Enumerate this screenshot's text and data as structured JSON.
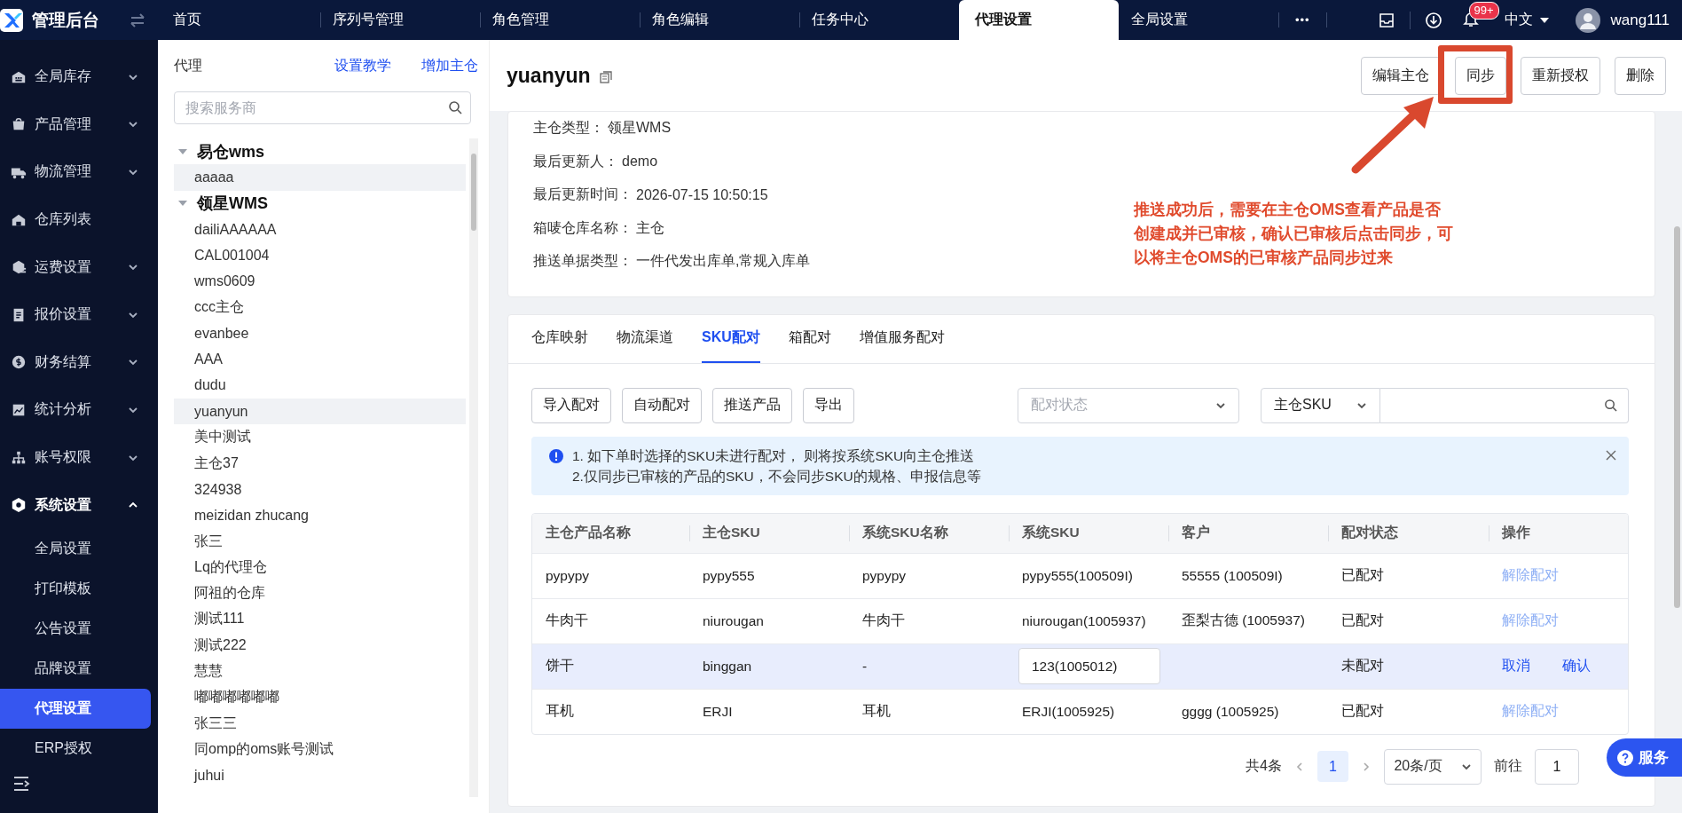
{
  "topbar": {
    "logo": "管理后台",
    "tabs": [
      {
        "label": "首页",
        "selected": false
      },
      {
        "label": "序列号管理",
        "selected": false
      },
      {
        "label": "角色管理",
        "selected": false
      },
      {
        "label": "角色编辑",
        "selected": false
      },
      {
        "label": "任务中心",
        "selected": false
      },
      {
        "label": "代理设置",
        "selected": true
      },
      {
        "label": "全局设置",
        "selected": false
      }
    ],
    "more": "•••",
    "badge": "99+",
    "language": "中文",
    "user": "wang111"
  },
  "sidebar": {
    "items": [
      {
        "label": "全局库存",
        "kind": "group",
        "expanded": false
      },
      {
        "label": "产品管理",
        "kind": "group",
        "expanded": false
      },
      {
        "label": "物流管理",
        "kind": "group",
        "expanded": false
      },
      {
        "label": "仓库列表",
        "kind": "link"
      },
      {
        "label": "运费设置",
        "kind": "group",
        "expanded": false
      },
      {
        "label": "报价设置",
        "kind": "group",
        "expanded": false
      },
      {
        "label": "财务结算",
        "kind": "group",
        "expanded": false
      },
      {
        "label": "统计分析",
        "kind": "group",
        "expanded": false
      },
      {
        "label": "账号权限",
        "kind": "group",
        "expanded": false
      },
      {
        "label": "系统设置",
        "kind": "group",
        "expanded": true,
        "children": [
          {
            "label": "全局设置",
            "selected": false
          },
          {
            "label": "打印模板",
            "selected": false
          },
          {
            "label": "公告设置",
            "selected": false
          },
          {
            "label": "品牌设置",
            "selected": false
          },
          {
            "label": "代理设置",
            "selected": true
          },
          {
            "label": "ERP授权",
            "selected": false
          }
        ]
      }
    ]
  },
  "agent_panel": {
    "title": "代理",
    "links": [
      "设置教学",
      "增加主仓"
    ],
    "search": {
      "placeholder": "搜索服务商"
    },
    "tree": [
      {
        "label": "易仓wms",
        "expanded": true,
        "children": [
          {
            "label": "aaaaa",
            "selected": false,
            "hovered": true
          }
        ]
      },
      {
        "label": "领星WMS",
        "expanded": true,
        "children": [
          {
            "label": "dailiAAAAAA",
            "selected": false,
            "hovered": false
          },
          {
            "label": "CAL001004",
            "selected": false,
            "hovered": false
          },
          {
            "label": "wms0609",
            "selected": false,
            "hovered": false
          },
          {
            "label": "ccc主仓",
            "selected": false,
            "hovered": false
          },
          {
            "label": "evanbee",
            "selected": false,
            "hovered": false
          },
          {
            "label": "AAA",
            "selected": false,
            "hovered": false
          },
          {
            "label": "dudu",
            "selected": false,
            "hovered": false
          },
          {
            "label": "yuanyun",
            "selected": true,
            "hovered": false
          },
          {
            "label": "美中测试",
            "selected": false,
            "hovered": false
          },
          {
            "label": "主仓37",
            "selected": false,
            "hovered": false
          },
          {
            "label": "324938",
            "selected": false,
            "hovered": false
          },
          {
            "label": "meizidan zhucang",
            "selected": false,
            "hovered": false
          },
          {
            "label": "张三",
            "selected": false,
            "hovered": false
          },
          {
            "label": "Lq的代理仓",
            "selected": false,
            "hovered": false
          },
          {
            "label": "阿祖的仓库",
            "selected": false,
            "hovered": false
          },
          {
            "label": "测试111",
            "selected": false,
            "hovered": false
          },
          {
            "label": "测试222",
            "selected": false,
            "hovered": false
          },
          {
            "label": "慧慧",
            "selected": false,
            "hovered": false
          },
          {
            "label": "嘟嘟嘟嘟嘟嘟",
            "selected": false,
            "hovered": false
          },
          {
            "label": "张三三",
            "selected": false,
            "hovered": false
          },
          {
            "label": "同omp的oms账号测试",
            "selected": false,
            "hovered": false
          },
          {
            "label": "juhui",
            "selected": false,
            "hovered": false
          }
        ]
      }
    ]
  },
  "detail": {
    "title": "yuanyun",
    "buttons": [
      "编辑主仓",
      "同步",
      "重新授权",
      "删除"
    ],
    "info": [
      {
        "label": "主仓类型：",
        "value": "领星WMS"
      },
      {
        "label": "最后更新人：",
        "value": "demo"
      },
      {
        "label": "最后更新时间：",
        "value": "2026-07-15 10:50:15"
      },
      {
        "label": "箱唛仓库名称：",
        "value": "主仓"
      },
      {
        "label": "推送单据类型：",
        "value": "一件代发出库单,常规入库单"
      }
    ],
    "annotation": {
      "lines": [
        "推送成功后，需要在主仓OMS查看产品是否",
        "创建成并已审核，确认已审核后点击同步，可",
        "以将主仓OMS的已审核产品同步过来"
      ]
    },
    "tabs": [
      {
        "label": "仓库映射",
        "selected": false
      },
      {
        "label": "物流渠道",
        "selected": false
      },
      {
        "label": "SKU配对",
        "selected": true
      },
      {
        "label": "箱配对",
        "selected": false
      },
      {
        "label": "增值服务配对",
        "selected": false
      }
    ],
    "toolbar": [
      "导入配对",
      "自动配对",
      "推送产品",
      "导出"
    ],
    "status_filter": {
      "placeholder": "配对状态"
    },
    "search_type": "主仓SKU",
    "alert": [
      "1. 如下单时选择的SKU未进行配对， 则将按系统SKU向主仓推送",
      "2.仅同步已审核的产品的SKU，不会同步SKU的规格、申报信息等"
    ],
    "table": {
      "columns": [
        "主仓产品名称",
        "主仓SKU",
        "系统SKU名称",
        "系统SKU",
        "客户",
        "配对状态",
        "操作"
      ],
      "rows": [
        {
          "editing": false,
          "cells": [
            "pypypy",
            "pypy555",
            "pypypy",
            "pypy555(100509I)",
            "55555 (100509I)",
            "已配对"
          ],
          "actions": [
            "解除配对"
          ]
        },
        {
          "editing": false,
          "cells": [
            "牛肉干",
            "niurougan",
            "牛肉干",
            "niurougan(1005937)",
            "歪梨古德 (1005937)",
            "已配对"
          ],
          "actions": [
            "解除配对"
          ]
        },
        {
          "editing": true,
          "cells": [
            "饼干",
            "binggan",
            "-",
            "123(1005012)",
            null,
            "未配对"
          ],
          "actions": [
            "取消",
            "确认"
          ]
        },
        {
          "editing": false,
          "cells": [
            "耳机",
            "ERJI",
            "耳机",
            "ERJI(1005925)",
            "gggg (1005925)",
            "已配对"
          ],
          "actions": [
            "解除配对"
          ]
        }
      ]
    },
    "pagination": {
      "total": "共4条",
      "pages": [
        {
          "label": "1",
          "selected": true
        }
      ],
      "page_size": "20条/页",
      "goto": "前往",
      "goto_value": "1"
    },
    "service": "服务"
  }
}
